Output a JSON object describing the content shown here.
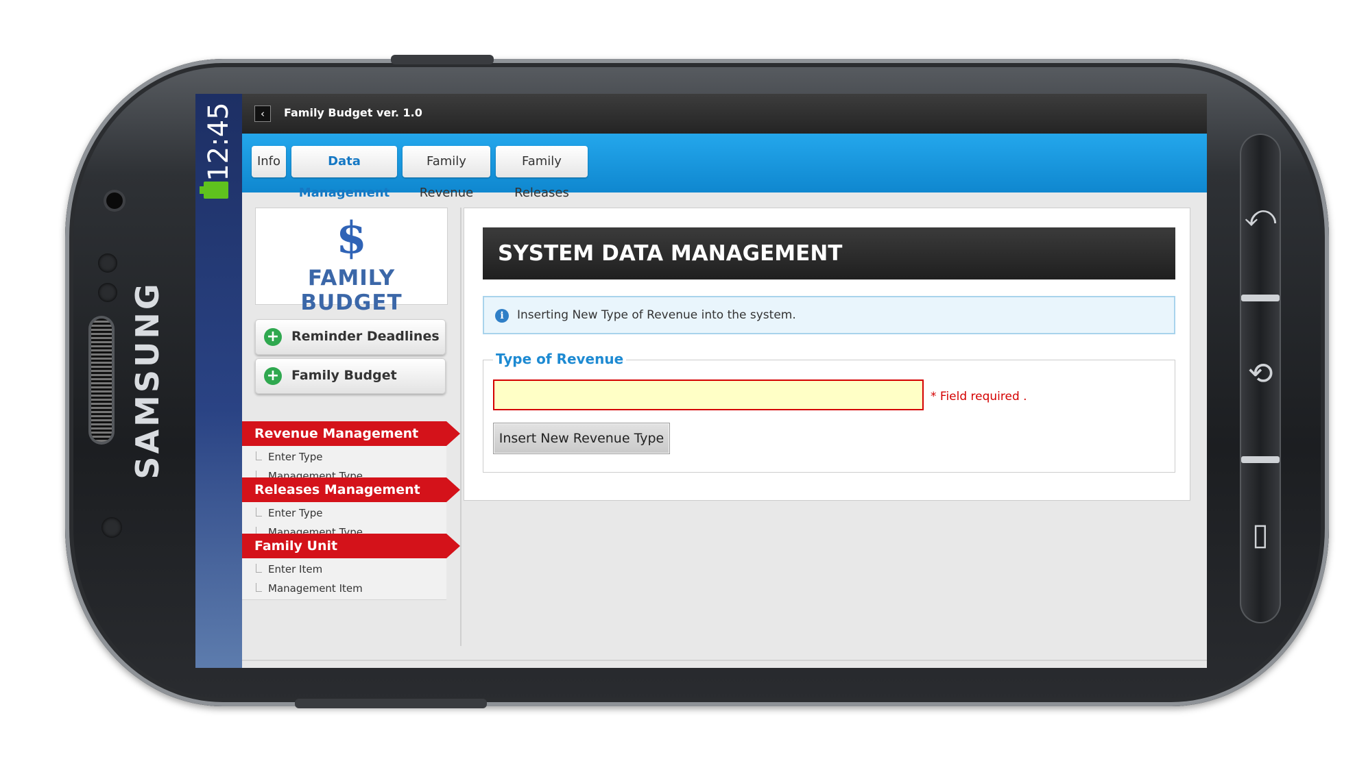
{
  "device": {
    "brand": "SAMSUNG",
    "clock": "12:45"
  },
  "app": {
    "title": "Family Budget ver. 1.0"
  },
  "tabs": [
    {
      "label": "Info",
      "active": false
    },
    {
      "label": "Data Management",
      "active": true
    },
    {
      "label": "Family Revenue",
      "active": false
    },
    {
      "label": "Family Releases",
      "active": false
    }
  ],
  "sidebar": {
    "logo": {
      "symbol": "$",
      "text": "FAMILY BUDGET"
    },
    "buttons": [
      {
        "label": "Reminder Deadlines",
        "icon": "plus-icon"
      },
      {
        "label": "Family Budget",
        "icon": "plus-icon"
      }
    ],
    "sections": [
      {
        "title": "Revenue Management Type",
        "items": [
          "Enter Type",
          "Management Type"
        ]
      },
      {
        "title": "Releases Management Type",
        "items": [
          "Enter Type",
          "Management Type"
        ]
      },
      {
        "title": "Family Unit",
        "items": [
          "Enter Item",
          "Management Item"
        ]
      }
    ]
  },
  "main": {
    "title": "SYSTEM DATA MANAGEMENT",
    "info": "Inserting New Type of Revenue into the system.",
    "form": {
      "legend": "Type of Revenue",
      "input_value": "",
      "required_text": "* Field required .",
      "submit_label": "Insert New Revenue Type"
    }
  },
  "colors": {
    "accent_blue": "#1c9ae0",
    "menu_red": "#d4121a",
    "title_dark": "#2a2a2a",
    "battery_green": "#5fc21e"
  }
}
